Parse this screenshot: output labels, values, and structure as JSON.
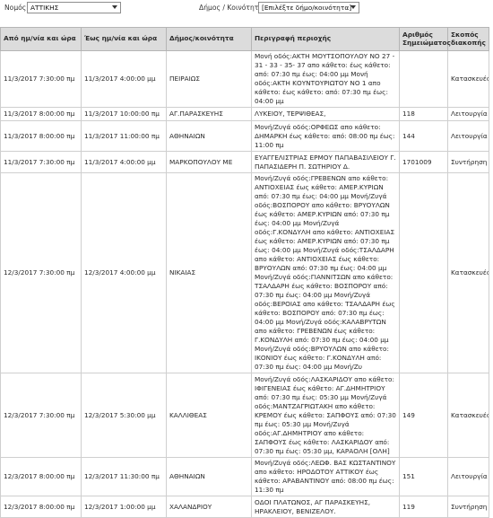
{
  "filters": {
    "nomos_label": "Νομός:",
    "nomos_value": "ΑΤΤΙΚΗΣ",
    "dimos_label": "Δήμος / Κοινότητα:",
    "dimos_value": "[Επιλέξτε δήμο/κοινότητα]"
  },
  "table": {
    "headers": [
      "Από ημ/νία και ώρα",
      "Έως ημ/νία και ώρα",
      "Δήμος/κοινότητα",
      "Περιγραφή περιοχής",
      "Αριθμός Σημειώματος",
      "Σκοπός διακοπής"
    ],
    "rows": [
      {
        "from": "11/3/2017 7:30:00 πμ",
        "to": "11/3/2017 4:00:00 μμ",
        "municipality": "ΠΕΙΡΑΙΩΣ",
        "description": "Μονή οδός:ΑΚΤΗ ΜΟΥΤΣΟΠΟΥΛΟΥ ΝΟ 27 - 31 - 33 - 35- 37 απο κάθετο: έως κάθετο: από: 07:30 πμ έως: 04:00 μμ Μονή οδός:ΑΚΤΗ ΚΟΥΝΤΟΥΡΙΩΤΟΥ ΝΟ 1 απο κάθετο: έως κάθετο: από: 07:30 πμ έως: 04:00 μμ",
        "note": "",
        "purpose": "Κατασκευές"
      },
      {
        "from": "11/3/2017 8:00:00 πμ",
        "to": "11/3/2017 10:00:00 πμ",
        "municipality": "ΑΓ.ΠΑΡΑΣΚΕΥΗΣ",
        "description": "ΛΥΚΕΙΟΥ, ΤΕΡΨΙΘΕΑΣ,",
        "note": "118",
        "purpose": "Λειτουργία"
      },
      {
        "from": "11/3/2017 8:00:00 πμ",
        "to": "11/3/2017 11:00:00 πμ",
        "municipality": "ΑΘΗΝΑΙΩΝ",
        "description": "Μονή/Ζυγά οδός:ΟΡΦΕΩΣ απο κάθετο: ΔΗΜΑΡΚΗ έως κάθετο: από: 08:00 πμ έως: 11:00 πμ",
        "note": "144",
        "purpose": "Λειτουργία"
      },
      {
        "from": "11/3/2017 7:30:00 πμ",
        "to": "11/3/2017 4:00:00 μμ",
        "municipality": "ΜΑΡΚΟΠΟΥΛΟΥ ΜΕ",
        "description": "ΕΥΑΓΓΕΛΙΣΤΡΙΑΣ ΕΡΜΟΥ ΠΑΠΑΒΑΣΙΛΕΙΟΥ Γ. ΠΑΠΑΣΙΔΕΡΗ Π. ΣΩΤΗΡΙΟΥ Δ.",
        "note": "1701009",
        "purpose": "Συντήρηση"
      },
      {
        "from": "12/3/2017 7:30:00 πμ",
        "to": "12/3/2017 4:00:00 μμ",
        "municipality": "ΝΙΚΑΙΑΣ",
        "description": "Μονή/Ζυγά οδός:ΓΡΕΒΕΝΩΝ απο κάθετο: ΑΝΤΙΟΧΕΙΑΣ έως κάθετο: ΑΜΕΡ.ΚΥΡΙΩΝ από: 07:30 πμ έως: 04:00 μμ Μονή/Ζυγά οδός:ΒΟΣΠΟΡΟΥ απο κάθετο: ΒΡΥΟΥΛΩΝ έως κάθετο: ΑΜΕΡ.ΚΥΡΙΩΝ από: 07:30 πμ έως: 04:00 μμ Μονή/Ζυγά οδός:Γ.ΚΟΝΔΥΛΗ απο κάθετο: ΑΝΤΙΟΧΕΙΑΣ έως κάθετο: ΑΜΕΡ.ΚΥΡΙΩΝ από: 07:30 πμ έως: 04:00 μμ Μονή/Ζυγά οδός:ΤΣΑΛΔΑΡΗ απο κάθετο: ΑΝΤΙΟΧΕΙΑΣ έως κάθετο: ΒΡΥΟΥΛΩΝ από: 07:30 πμ έως: 04:00 μμ Μονή/Ζυγά οδός:ΓΙΑΝΝΙΤΣΩΝ απο κάθετο: ΤΣΑΛΔΑΡΗ έως κάθετο: ΒΟΣΠΟΡΟΥ από: 07:30 πμ έως: 04:00 μμ Μονή/Ζυγά οδός:ΒΕΡΟΙΑΣ απο κάθετο: ΤΣΑΛΔΑΡΗ έως κάθετο: ΒΟΣΠΟΡΟΥ από: 07:30 πμ έως: 04:00 μμ Μονή/Ζυγά οδός:ΚΑΛΑΒΡΥΤΩΝ απο κάθετο: ΓΡΕΒΕΝΩΝ έως κάθετο: Γ.ΚΟΝΔΥΛΗ από: 07:30 πμ έως: 04:00 μμ Μονή/Ζυγά οδός:ΒΡΥΟΥΛΩΝ απο κάθετο: ΙΚΟΝΙΟΥ έως κάθετο: Γ.ΚΟΝΔΥΛΗ από: 07:30 πμ έως: 04:00 μμ Μονή/Ζυ",
        "note": "",
        "purpose": "Κατασκευές"
      },
      {
        "from": "12/3/2017 7:30:00 πμ",
        "to": "12/3/2017 5:30:00 μμ",
        "municipality": "ΚΑΛΛΙΘΕΑΣ",
        "description": "Μονή/Ζυγά οδός:ΛΑΣΚΑΡΙΔΟΥ απο κάθετο: ΙΦΙΓΕΝΕΙΑΣ έως κάθετο: ΑΓ.ΔΗΜΗΤΡΙΟΥ από: 07:30 πμ έως: 05:30 μμ Μονή/Ζυγά οδός:ΜΑΝΤΖΑΓΡΙΩΤΑΚΗ απο κάθετο: ΚΡΕΜΟΥ έως κάθετο: ΣΑΠΦΟΥΣ από: 07:30 πμ έως: 05:30 μμ Μονή/Ζυγά οδός:ΑΓ.ΔΗΜΗΤΡΙΟΥ απο κάθετο: ΣΑΠΦΟΥΣ έως κάθετο: ΛΑΣΚΑΡΙΔΟΥ από: 07:30 πμ έως: 05:30 μμ, ΚΑΡΑΟΛΗ [ΟΛΗ]",
        "note": "149",
        "purpose": "Κατασκευές"
      },
      {
        "from": "12/3/2017 8:00:00 πμ",
        "to": "12/3/2017 11:30:00 πμ",
        "municipality": "ΑΘΗΝΑΙΩΝ",
        "description": "Μονή/Ζυγά οδός:ΛΕΩΦ. ΒΑΣ ΚΩΣΤΑΝΤΙΝΟΥ απο κάθετο: ΗΡΟΔΟΤΟΥ ΑΤΤΙΚΟΥ έως κάθετο: ΑΡΑΒΑΝΤΙΝΟΥ από: 08:00 πμ έως: 11:30 πμ",
        "note": "151",
        "purpose": "Λειτουργία"
      },
      {
        "from": "12/3/2017 8:00:00 πμ",
        "to": "12/3/2017 1:00:00 μμ",
        "municipality": "ΧΑΛΑΝΔΡΙΟΥ",
        "description": "ΟΔΟΙ ΠΛΑΤΩΝΟΣ, ΑΓ ΠΑΡΑΣΚΕΥΗΣ, ΗΡΑΚΛΕΙΟΥ, ΒΕΝΙΖΕΛΟΥ.",
        "note": "119",
        "purpose": "Συντήρηση"
      }
    ]
  }
}
